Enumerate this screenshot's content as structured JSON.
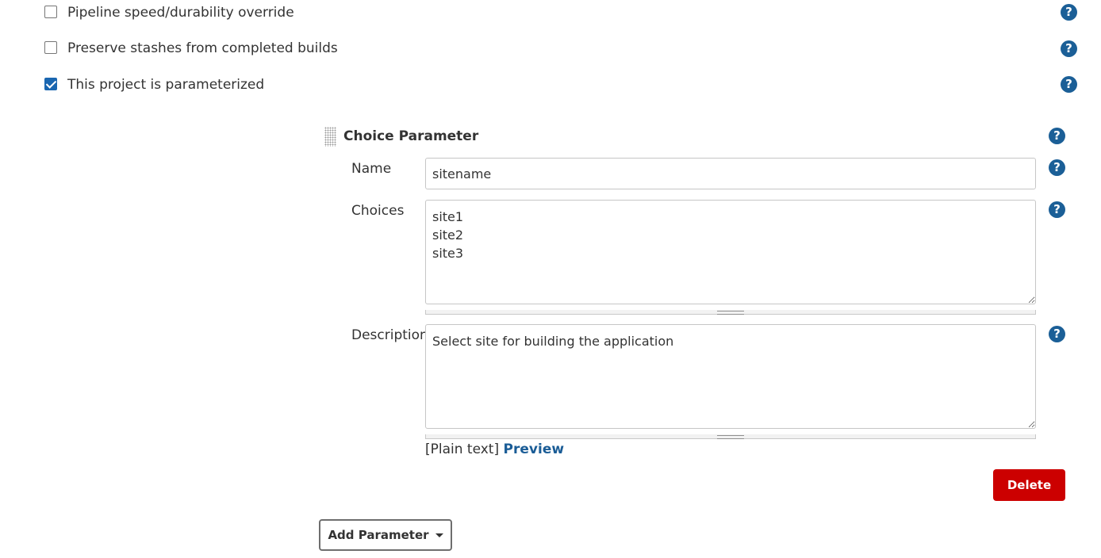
{
  "options": [
    {
      "label": "Pipeline speed/durability override",
      "checked": false
    },
    {
      "label": "Preserve stashes from completed builds",
      "checked": false
    },
    {
      "label": "This project is parameterized",
      "checked": true
    }
  ],
  "help_glyph": "?",
  "colors": {
    "help": "#1b5f97",
    "checkbox": "#1a66b0",
    "delete": "#cc0000",
    "link": "#1a5c96"
  },
  "parameter": {
    "title": "Choice Parameter",
    "name_label": "Name",
    "name_value": "sitename",
    "choices_label": "Choices",
    "choices_value": "site1\nsite2\nsite3",
    "description_label": "Description",
    "description_value": "Select site for building the application",
    "plain_text": "[Plain text]",
    "preview_link": "Preview",
    "delete_label": "Delete"
  },
  "add_parameter_label": "Add Parameter"
}
